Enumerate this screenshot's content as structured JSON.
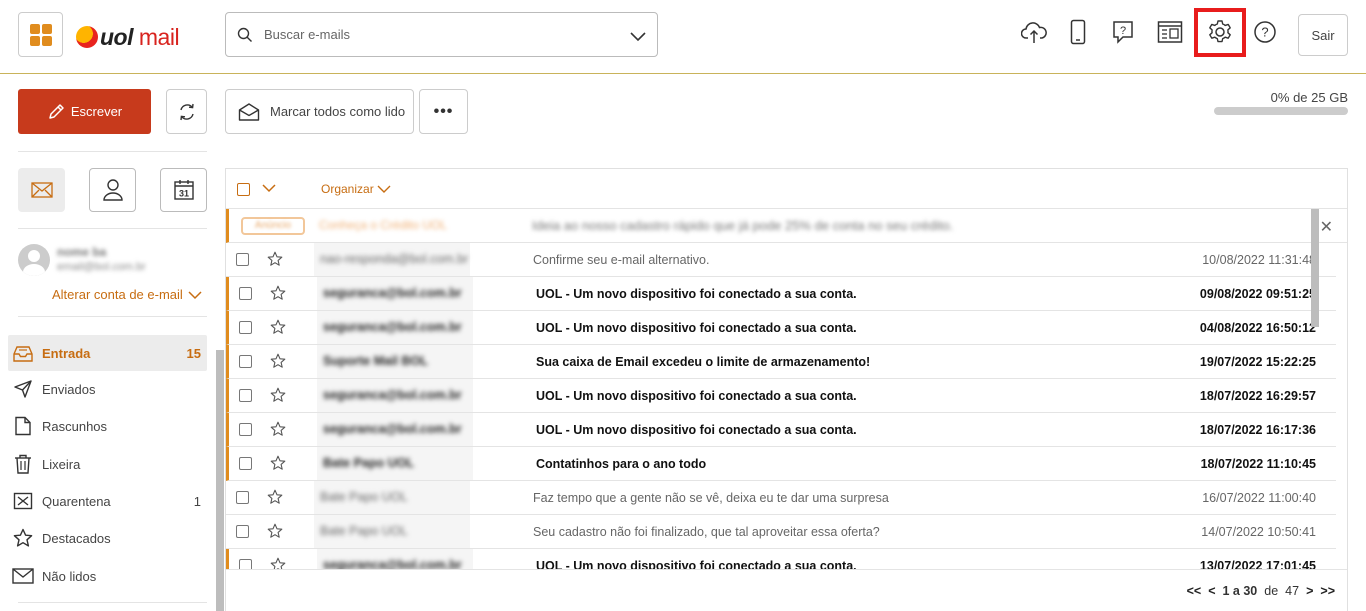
{
  "header": {
    "logo_brand": "uol",
    "logo_product": "mail",
    "search_placeholder": "Buscar e-mails",
    "logout_label": "Sair",
    "accent": "#c73a1c",
    "highlight_box_color": "#e81c1c"
  },
  "toolbar": {
    "write_label": "Escrever",
    "mark_all_read_label": "Marcar todos como lido",
    "more_label": "•••",
    "quota_text": "0% de 25 GB",
    "quota_used_percent": 0
  },
  "sidebar": {
    "account_name": "nome ba",
    "account_email": "email@bol.com.br",
    "switch_account_label": "Alterar conta de e-mail",
    "calendar_day": "31",
    "folders": [
      {
        "label": "Entrada",
        "count": "15",
        "icon": "inbox-icon",
        "active": true
      },
      {
        "label": "Enviados",
        "count": "",
        "icon": "send-icon",
        "active": false
      },
      {
        "label": "Rascunhos",
        "count": "",
        "icon": "draft-icon",
        "active": false
      },
      {
        "label": "Lixeira",
        "count": "",
        "icon": "trash-icon",
        "active": false
      },
      {
        "label": "Quarentena",
        "count": "1",
        "icon": "quarantine-icon",
        "active": false
      },
      {
        "label": "Destacados",
        "count": "",
        "icon": "star-icon",
        "active": false
      },
      {
        "label": "Não lidos",
        "count": "",
        "icon": "envelope-icon",
        "active": false
      }
    ]
  },
  "list": {
    "organize_label": "Organizar",
    "promo": {
      "badge": "Anúncio",
      "sender": "Conheça o Crédito UOL",
      "subject": "Ideia ao nosso cadastro rápido que já pode 25% de conta no seu crédito."
    },
    "rows": [
      {
        "sender": "nao-responda@bol.com.br",
        "subject": "Confirme seu e-mail alternativo.",
        "date": "10/08/2022 11:31:48",
        "unread": false
      },
      {
        "sender": "seguranca@bol.com.br",
        "subject": "UOL - Um novo dispositivo foi conectado a sua conta.",
        "date": "09/08/2022 09:51:25",
        "unread": true
      },
      {
        "sender": "seguranca@bol.com.br",
        "subject": "UOL - Um novo dispositivo foi conectado a sua conta.",
        "date": "04/08/2022 16:50:12",
        "unread": true
      },
      {
        "sender": "Suporte Mail BOL",
        "subject": "Sua caixa de Email excedeu o limite de armazenamento!",
        "date": "19/07/2022 15:22:25",
        "unread": true
      },
      {
        "sender": "seguranca@bol.com.br",
        "subject": "UOL - Um novo dispositivo foi conectado a sua conta.",
        "date": "18/07/2022 16:29:57",
        "unread": true
      },
      {
        "sender": "seguranca@bol.com.br",
        "subject": "UOL - Um novo dispositivo foi conectado a sua conta.",
        "date": "18/07/2022 16:17:36",
        "unread": true
      },
      {
        "sender": "Bate Papo UOL",
        "subject": "Contatinhos para o ano todo",
        "date": "18/07/2022 11:10:45",
        "unread": true
      },
      {
        "sender": "Bate Papo UOL",
        "subject": "Faz tempo que a gente não se vê, deixa eu te dar uma surpresa",
        "date": "16/07/2022 11:00:40",
        "unread": false
      },
      {
        "sender": "Bate Papo UOL",
        "subject": "Seu cadastro não foi finalizado, que tal aproveitar essa oferta?",
        "date": "14/07/2022 10:50:41",
        "unread": false
      },
      {
        "sender": "seguranca@bol.com.br",
        "subject": "UOL - Um novo dispositivo foi conectado a sua conta.",
        "date": "13/07/2022 17:01:45",
        "unread": true
      }
    ],
    "pager": {
      "first": "<<",
      "prev": "<",
      "range": "1 a 30",
      "of_label": "de",
      "total": "47",
      "next": ">",
      "last": ">>"
    }
  }
}
